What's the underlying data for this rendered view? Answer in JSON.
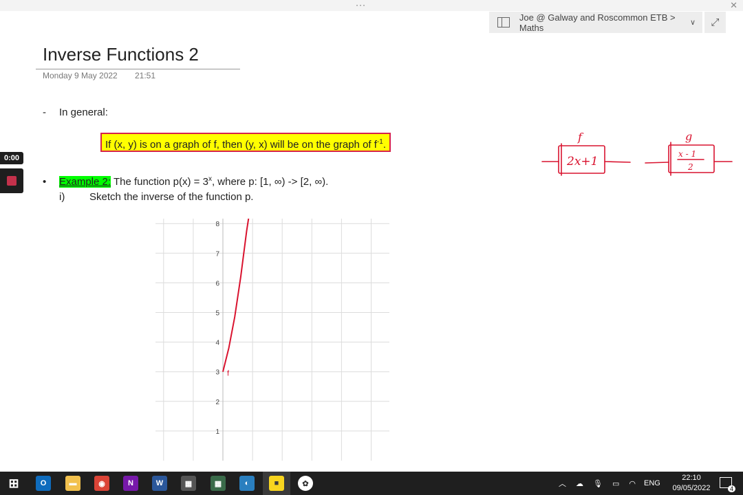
{
  "window": {
    "menu_dots": "···",
    "close_glyph": "✕"
  },
  "breadcrumb": {
    "text": "Joe @ Galway and Roscommon ETB > Maths",
    "chevron": "∨"
  },
  "expand_glyph": "⤢",
  "page": {
    "title": "Inverse Functions 2",
    "date": "Monday 9 May 2022",
    "time": "21:51",
    "general_dash": "-",
    "general_text": "In general:",
    "highlight_pre": "If (x, y) is on a graph of f, then (y, x) will be on the graph of f",
    "highlight_sup": "-1",
    "highlight_post": ".",
    "example_bullet": "•",
    "example_label": "Example 2:",
    "example_pre": " The function p(x) = 3",
    "example_sup": "x",
    "example_post": ", where p: [1, ∞) -> [2, ∞).",
    "part_num": "i)",
    "part_text": "Sketch the inverse of the function p."
  },
  "recorder": {
    "timer": "0:00"
  },
  "ink": {
    "f_label": "f",
    "f_box": "2x+1",
    "g_label": "g",
    "g_num": "x - 1",
    "g_den": "2"
  },
  "chart_data": {
    "type": "line",
    "title": "",
    "xlabel": "",
    "ylabel": "",
    "x_ticks": [],
    "y_ticks": [
      "1",
      "2",
      "3",
      "4",
      "5",
      "6",
      "7",
      "8"
    ],
    "ylim": [
      0,
      8.4
    ],
    "xlim": [
      -2,
      6
    ],
    "series": [
      {
        "name": "f",
        "color": "#d9122e",
        "x": [
          0.0,
          0.2,
          0.4,
          0.6,
          0.8,
          0.9
        ],
        "y": [
          3.0,
          3.8,
          4.85,
          6.2,
          7.75,
          8.4
        ]
      }
    ],
    "annotations": [
      {
        "text": "f"
      }
    ]
  },
  "taskbar": {
    "icons": [
      {
        "name": "windows-start-icon",
        "glyph": "⊞",
        "color": "#1f1f1f"
      },
      {
        "name": "outlook-icon",
        "glyph": "O",
        "color": "#0f6cbd"
      },
      {
        "name": "file-explorer-icon",
        "glyph": "▬",
        "color": "#f2c14e"
      },
      {
        "name": "chrome-icon",
        "glyph": "◉",
        "color": "#db4437"
      },
      {
        "name": "onenote-icon",
        "glyph": "N",
        "color": "#7719aa"
      },
      {
        "name": "word-icon",
        "glyph": "W",
        "color": "#2b579a"
      },
      {
        "name": "calculator-icon",
        "glyph": "▦",
        "color": "#555555"
      },
      {
        "name": "calculator2-icon",
        "glyph": "▦",
        "color": "#3a6b4a"
      },
      {
        "name": "edge-icon",
        "glyph": "◐",
        "color": "#2a7fbf"
      },
      {
        "name": "sticky-notes-icon",
        "glyph": "■",
        "color": "#f7d000"
      },
      {
        "name": "app-icon",
        "glyph": "✿",
        "color": "#ffffff"
      }
    ],
    "tray": {
      "lang": "ENG",
      "time": "22:10",
      "date": "09/05/2022",
      "notifications": "4"
    }
  }
}
